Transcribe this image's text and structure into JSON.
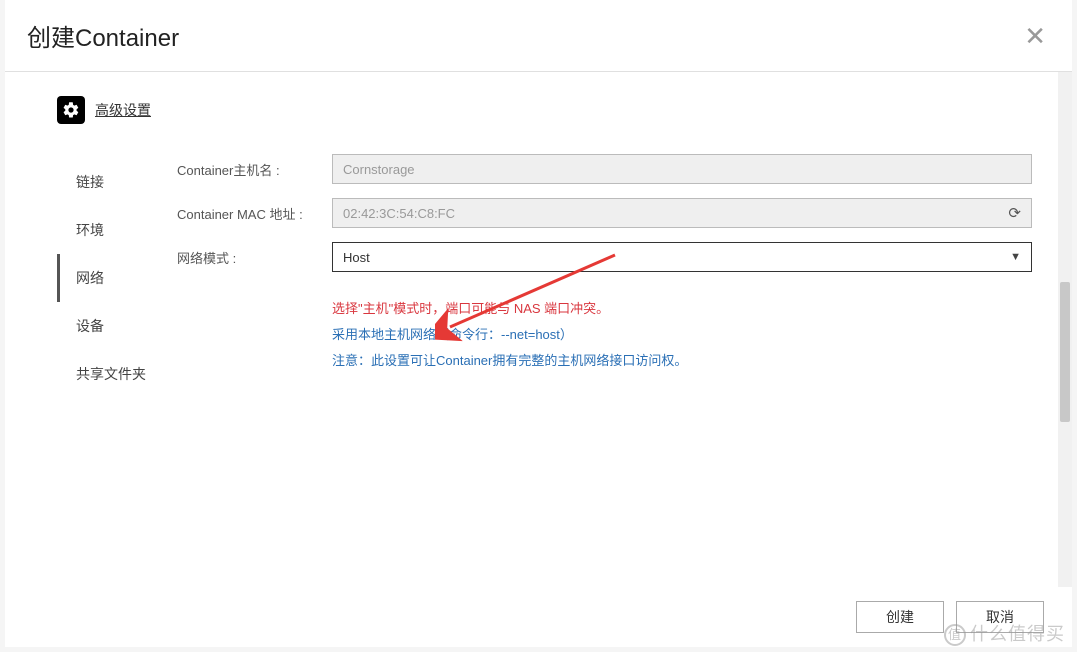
{
  "header": {
    "title": "创建Container",
    "close_glyph": "✕"
  },
  "adv": {
    "label": "高级设置"
  },
  "sidebar": {
    "items": [
      {
        "label": "链接",
        "active": false
      },
      {
        "label": "环境",
        "active": false
      },
      {
        "label": "网络",
        "active": true
      },
      {
        "label": "设备",
        "active": false
      },
      {
        "label": "共享文件夹",
        "active": false
      }
    ]
  },
  "form": {
    "hostname_label": "Container主机名 :",
    "hostname_value": "Cornstorage",
    "mac_label": "Container MAC 地址 :",
    "mac_value": "02:42:3C:54:C8:FC",
    "mode_label": "网络模式 :",
    "mode_value": "Host"
  },
  "notes": {
    "warn": "选择\"主机\"模式时，端口可能与 NAS 端口冲突。",
    "info1": "采用本地主机网络（命令行：--net=host）",
    "info2": "注意：此设置可让Container拥有完整的主机网络接口访问权。"
  },
  "footer": {
    "create": "创建",
    "cancel": "取消"
  },
  "watermark": "什么值得买"
}
